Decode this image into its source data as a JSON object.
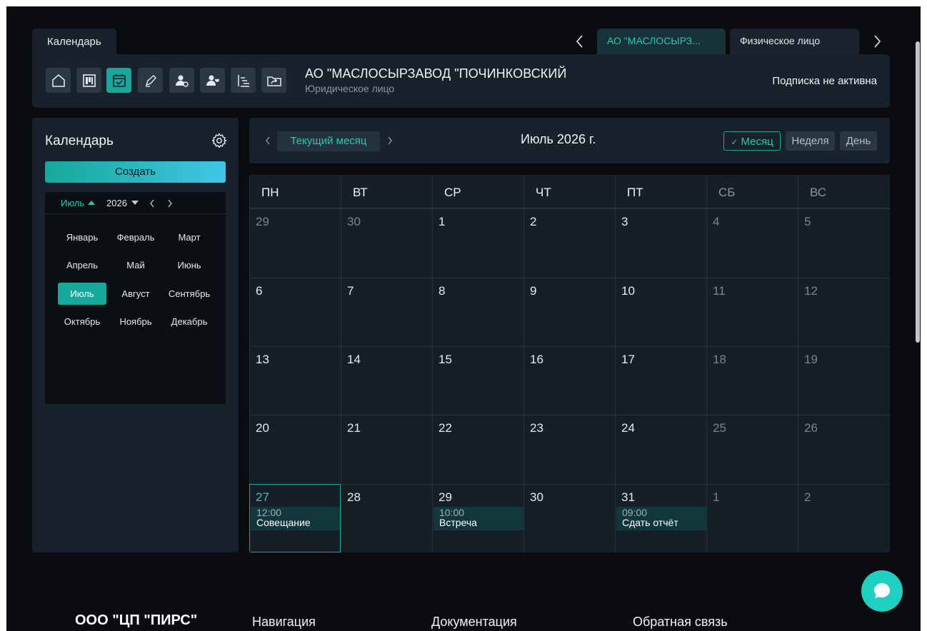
{
  "tabs": {
    "main_tab": "Календарь",
    "company_tabs": [
      "АО \"МАСЛОСЫРЗ...",
      "Физическое лицо"
    ]
  },
  "header": {
    "company_name": "АО \"МАСЛОСЫРЗАВОД \"ПОЧИНКОВСКИЙ",
    "company_type": "Юридическое лицо",
    "subscription_status": "Подписка не активна",
    "tool_icons": [
      "home-icon",
      "board-icon",
      "calendar-check-icon",
      "pen-icon",
      "user-settings-icon",
      "user-heart-icon",
      "hierarchy-icon",
      "folder-share-icon"
    ],
    "active_tool": "calendar-check-icon"
  },
  "sidebar": {
    "title": "Календарь",
    "create_label": "Создать",
    "mini_calendar": {
      "month": "Июль",
      "year": "2026",
      "months": [
        "Январь",
        "Февраль",
        "Март",
        "Апрель",
        "Май",
        "Июнь",
        "Июль",
        "Август",
        "Сентябрь",
        "Октябрь",
        "Ноябрь",
        "Декабрь"
      ],
      "selected_month": "Июль"
    }
  },
  "calendar": {
    "current_month_label": "Текущий месяц",
    "title": "Июль 2026 г.",
    "views": {
      "month": "Месяц",
      "week": "Неделя",
      "day": "День"
    },
    "active_view": "month",
    "weekdays": [
      "ПН",
      "ВТ",
      "СР",
      "ЧТ",
      "ПТ",
      "СБ",
      "ВС"
    ],
    "weeks": [
      [
        "29",
        "30",
        "1",
        "2",
        "3",
        "4",
        "5"
      ],
      [
        "6",
        "7",
        "8",
        "9",
        "10",
        "11",
        "12"
      ],
      [
        "13",
        "14",
        "15",
        "16",
        "17",
        "18",
        "19"
      ],
      [
        "20",
        "21",
        "22",
        "23",
        "24",
        "25",
        "26"
      ],
      [
        "27",
        "28",
        "29",
        "30",
        "31",
        "1",
        "2"
      ]
    ],
    "today": "27",
    "events": [
      {
        "day": "27",
        "time": "12:00",
        "title": "Совещание"
      },
      {
        "day": "29",
        "time": "10:00",
        "title": "Встреча"
      },
      {
        "day": "31",
        "time": "09:00",
        "title": "Сдать отчёт"
      }
    ]
  },
  "footer": {
    "brand": "ООО \"ЦП \"ПИРС\"",
    "sections": [
      "Навигация",
      "Документация",
      "Обратная связь"
    ]
  },
  "colors": {
    "accent": "#1ea593",
    "background": "#0a0c10",
    "panel": "#18222c"
  }
}
